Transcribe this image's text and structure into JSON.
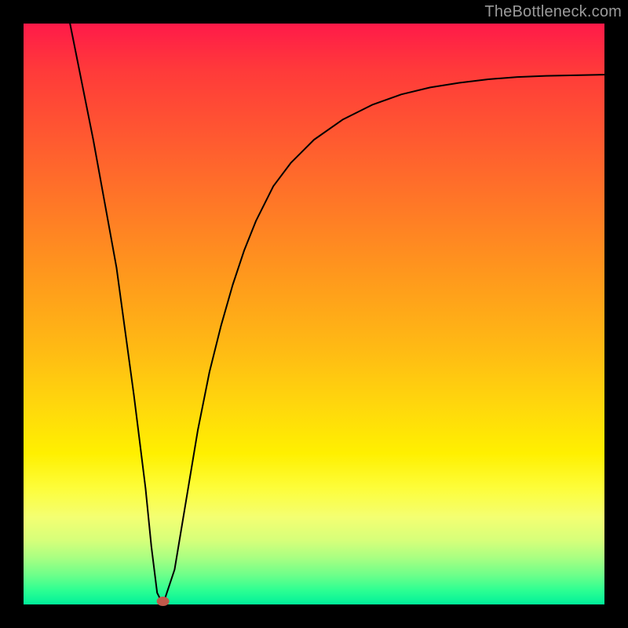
{
  "watermark": "TheBottleneck.com",
  "colors": {
    "frame_bg": "#000000",
    "curve": "#000000",
    "marker": "#c0594b",
    "gradient_top": "#ff1a49",
    "gradient_mid": "#ffd80c",
    "gradient_bottom": "#00f09a",
    "watermark_text": "#9a9a9a"
  },
  "chart_data": {
    "type": "line",
    "title": "",
    "xlabel": "",
    "ylabel": "",
    "xlim": [
      0,
      100
    ],
    "ylim": [
      0,
      100
    ],
    "grid": false,
    "legend": false,
    "series": [
      {
        "name": "curve",
        "x": [
          8,
          12,
          16,
          19,
          21,
          22,
          23,
          24,
          26,
          28,
          30,
          32,
          34,
          36,
          38,
          40,
          43,
          46,
          50,
          55,
          60,
          65,
          70,
          75,
          80,
          85,
          90,
          95,
          100
        ],
        "y": [
          100,
          80,
          58,
          36,
          20,
          10,
          2,
          0,
          6,
          18,
          30,
          40,
          48,
          55,
          61,
          66,
          72,
          76,
          80,
          83.5,
          86,
          87.8,
          89,
          89.8,
          90.4,
          90.8,
          91,
          91.1,
          91.2
        ]
      }
    ],
    "marker": {
      "x": 24,
      "y": 0
    }
  }
}
